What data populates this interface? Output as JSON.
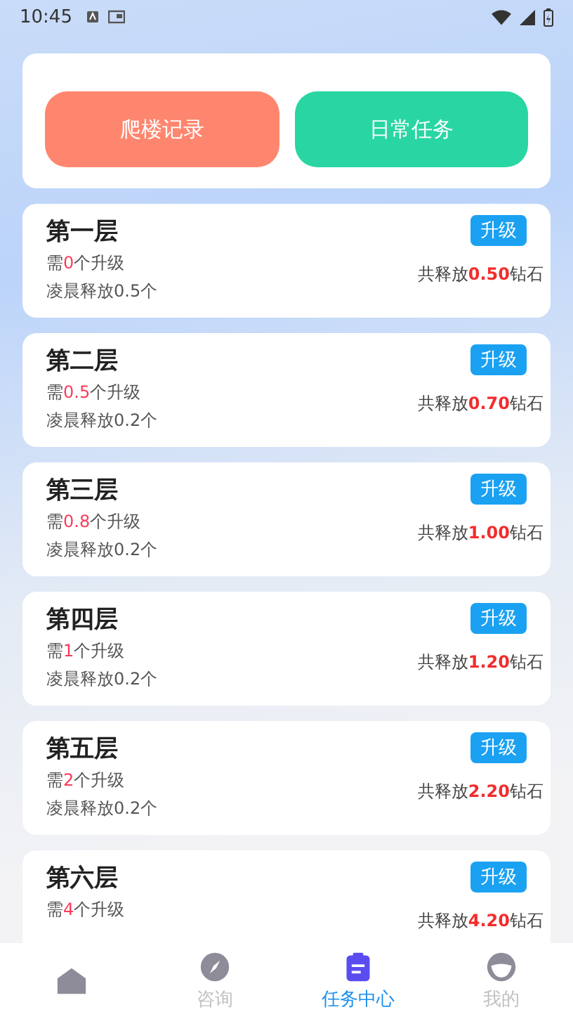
{
  "status_bar": {
    "time": "10:45"
  },
  "actions": [
    {
      "label": "爬楼记录",
      "kind": "record"
    },
    {
      "label": "日常任务",
      "kind": "task"
    }
  ],
  "floors": [
    {
      "title": "第一层",
      "need_prefix": "需",
      "need": "0",
      "need_suffix": "个升级",
      "release": "凌晨释放0.5个",
      "button": "升级",
      "total_prefix": "共释放",
      "total": "0.50",
      "total_suffix": "钻石"
    },
    {
      "title": "第二层",
      "need_prefix": "需",
      "need": "0.5",
      "need_suffix": "个升级",
      "release": "凌晨释放0.2个",
      "button": "升级",
      "total_prefix": "共释放",
      "total": "0.70",
      "total_suffix": "钻石"
    },
    {
      "title": "第三层",
      "need_prefix": "需",
      "need": "0.8",
      "need_suffix": "个升级",
      "release": "凌晨释放0.2个",
      "button": "升级",
      "total_prefix": "共释放",
      "total": "1.00",
      "total_suffix": "钻石"
    },
    {
      "title": "第四层",
      "need_prefix": "需",
      "need": "1",
      "need_suffix": "个升级",
      "release": "凌晨释放0.2个",
      "button": "升级",
      "total_prefix": "共释放",
      "total": "1.20",
      "total_suffix": "钻石"
    },
    {
      "title": "第五层",
      "need_prefix": "需",
      "need": "2",
      "need_suffix": "个升级",
      "release": "凌晨释放0.2个",
      "button": "升级",
      "total_prefix": "共释放",
      "total": "2.20",
      "total_suffix": "钻石"
    },
    {
      "title": "第六层",
      "need_prefix": "需",
      "need": "4",
      "need_suffix": "个升级",
      "button": "升级",
      "total_prefix": "共释放",
      "total": "4.20",
      "total_suffix": "钻石"
    }
  ],
  "tab_bar": [
    {
      "kind": "home",
      "selected": false
    },
    {
      "kind": "compass",
      "label": "咨询",
      "selected": false
    },
    {
      "kind": "clipboard",
      "label": "任务中心",
      "selected": true
    },
    {
      "kind": "profile",
      "label": "我的",
      "selected": false
    }
  ]
}
